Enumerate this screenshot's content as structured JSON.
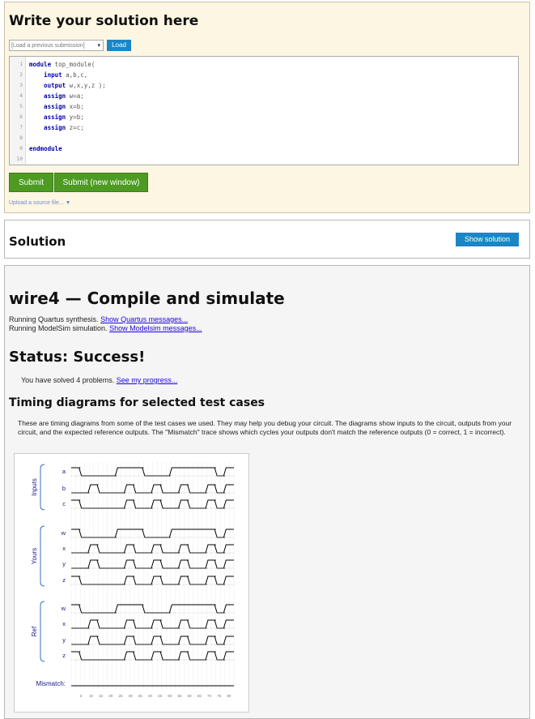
{
  "editor_panel": {
    "title": "Write your solution here",
    "load_select": "[Load a previous submission]",
    "load_button": "Load",
    "code_lines": [
      {
        "n": "1",
        "parts": [
          {
            "t": "module",
            "k": true
          },
          {
            "t": " top_module(",
            "k": false
          }
        ]
      },
      {
        "n": "2",
        "parts": [
          {
            "t": "    input",
            "k": true
          },
          {
            "t": " a,b,c,",
            "k": false
          }
        ]
      },
      {
        "n": "3",
        "parts": [
          {
            "t": "    output",
            "k": true
          },
          {
            "t": " w,x,y,z );",
            "k": false
          }
        ]
      },
      {
        "n": "4",
        "parts": [
          {
            "t": "    assign",
            "k": true
          },
          {
            "t": " w=a;",
            "k": false
          }
        ]
      },
      {
        "n": "5",
        "parts": [
          {
            "t": "    assign",
            "k": true
          },
          {
            "t": " x=b;",
            "k": false
          }
        ]
      },
      {
        "n": "6",
        "parts": [
          {
            "t": "    assign",
            "k": true
          },
          {
            "t": " y=b;",
            "k": false
          }
        ]
      },
      {
        "n": "7",
        "parts": [
          {
            "t": "    assign",
            "k": true
          },
          {
            "t": " z=c;",
            "k": false
          }
        ]
      },
      {
        "n": "8",
        "parts": []
      },
      {
        "n": "9",
        "parts": [
          {
            "t": "endmodule",
            "k": true
          }
        ]
      },
      {
        "n": "10",
        "parts": []
      }
    ],
    "submit_label": "Submit",
    "submit_new_window_label": "Submit (new window)",
    "upload_label": "Upload a source file... ▼"
  },
  "solution_panel": {
    "title": "Solution",
    "show_solution_label": "Show solution"
  },
  "results_panel": {
    "title": "wire4 — Compile and simulate",
    "quartus_text": "Running Quartus synthesis. ",
    "quartus_link": "Show Quartus messages...",
    "modelsim_text": "Running ModelSim simulation. ",
    "modelsim_link": "Show Modelsim messages...",
    "status": "Status: Success!",
    "solved_text": "You have solved 4 problems. ",
    "progress_link": "See my progress...",
    "timing_title": "Timing diagrams for selected test cases",
    "timing_desc": "These are timing diagrams from some of the test cases we used. They may help you debug your circuit. The diagrams show inputs to the circuit, outputs from your circuit, and the expected reference outputs. The \"Mismatch\" trace shows which cycles your outputs don't match the reference outputs (0 = correct, 1 = incorrect)."
  },
  "timing": {
    "groups": [
      {
        "name": "Inputs",
        "signals": [
          "a",
          "b",
          "c"
        ]
      },
      {
        "name": "Yours",
        "signals": [
          "w",
          "x",
          "y",
          "z"
        ]
      },
      {
        "name": "Ref",
        "signals": [
          "w",
          "x",
          "y",
          "z"
        ]
      }
    ],
    "mismatch_label": "Mismatch:",
    "ticks": [
      "5",
      "10",
      "15",
      "20",
      "25",
      "30",
      "35",
      "40",
      "45",
      "50",
      "55",
      "60",
      "65",
      "70",
      "75",
      "80"
    ],
    "waves": {
      "a": [
        1,
        0,
        0,
        0,
        0,
        1,
        1,
        1,
        0,
        0,
        0,
        1,
        1,
        1,
        1,
        1,
        0,
        1
      ],
      "b": [
        0,
        0,
        1,
        0,
        0,
        0,
        1,
        0,
        0,
        1,
        0,
        0,
        1,
        0,
        0,
        1,
        0,
        1
      ],
      "c": [
        1,
        0,
        0,
        0,
        0,
        0,
        1,
        0,
        0,
        1,
        0,
        0,
        1,
        0,
        0,
        1,
        0,
        1
      ],
      "w": [
        1,
        0,
        0,
        0,
        0,
        1,
        1,
        1,
        0,
        0,
        0,
        1,
        1,
        1,
        1,
        1,
        0,
        1
      ],
      "x": [
        0,
        0,
        1,
        0,
        0,
        0,
        1,
        0,
        0,
        1,
        0,
        0,
        1,
        0,
        0,
        1,
        0,
        1
      ],
      "y": [
        0,
        0,
        1,
        0,
        0,
        0,
        1,
        0,
        0,
        1,
        0,
        0,
        1,
        0,
        0,
        1,
        0,
        1
      ],
      "z": [
        1,
        0,
        0,
        0,
        0,
        0,
        1,
        0,
        0,
        1,
        0,
        0,
        1,
        0,
        0,
        1,
        0,
        1
      ]
    }
  }
}
